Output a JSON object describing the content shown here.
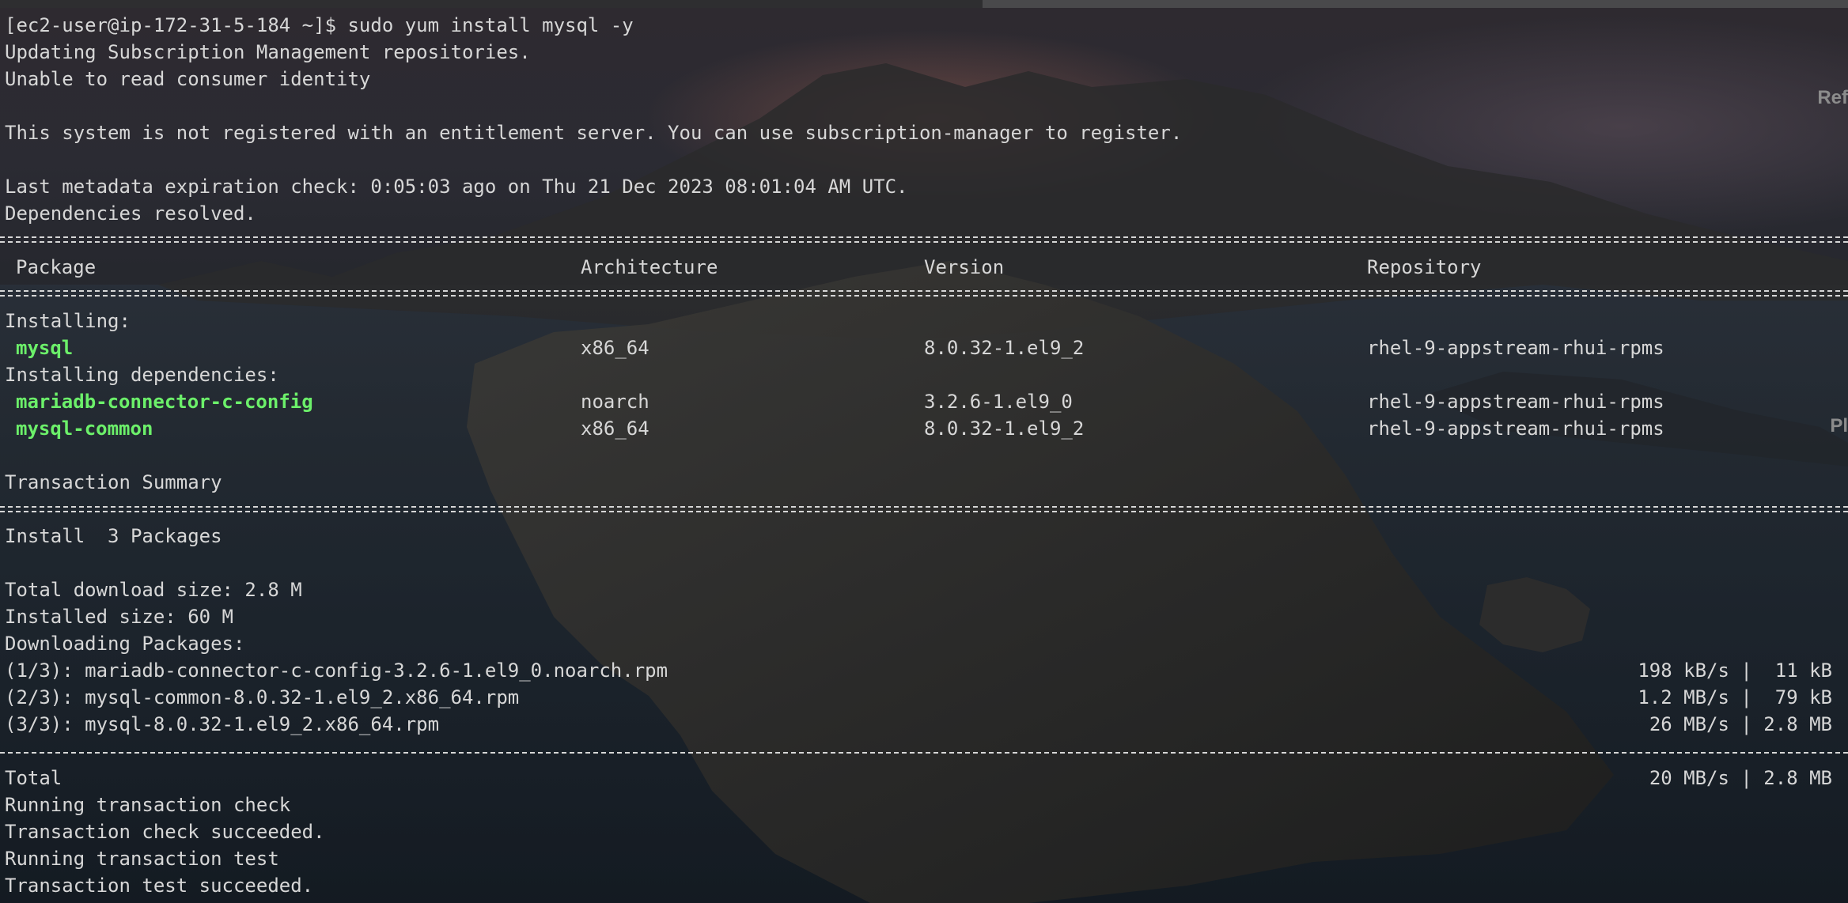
{
  "terminal": {
    "prompt": "[ec2-user@ip-172-31-5-184 ~]$ sudo yum install mysql -y",
    "line_updating": "Updating Subscription Management repositories.",
    "line_unable": "Unable to read consumer identity",
    "line_not_registered": "This system is not registered with an entitlement server. You can use subscription-manager to register.",
    "line_metadata": "Last metadata expiration check: 0:05:03 ago on Thu 21 Dec 2023 08:01:04 AM UTC.",
    "line_deps_resolved": "Dependencies resolved.",
    "table": {
      "headers": {
        "package": "Package",
        "architecture": "Architecture",
        "version": "Version",
        "repository": "Repository"
      },
      "installing_label": "Installing:",
      "installing": [
        {
          "name": "mysql",
          "arch": "x86_64",
          "version": "8.0.32-1.el9_2",
          "repo": "rhel-9-appstream-rhui-rpms"
        }
      ],
      "deps_label": "Installing dependencies:",
      "dependencies": [
        {
          "name": "mariadb-connector-c-config",
          "arch": "noarch",
          "version": "3.2.6-1.el9_0",
          "repo": "rhel-9-appstream-rhui-rpms"
        },
        {
          "name": "mysql-common",
          "arch": "x86_64",
          "version": "8.0.32-1.el9_2",
          "repo": "rhel-9-appstream-rhui-rpms"
        }
      ]
    },
    "transaction_summary": "Transaction Summary",
    "install_count": "Install  3 Packages",
    "total_download": "Total download size: 2.8 M",
    "installed_size": "Installed size: 60 M",
    "downloading": "Downloading Packages:",
    "downloads": [
      {
        "file": "(1/3): mariadb-connector-c-config-3.2.6-1.el9_0.noarch.rpm",
        "stats": "198 kB/s |  11 kB"
      },
      {
        "file": "(2/3): mysql-common-8.0.32-1.el9_2.x86_64.rpm",
        "stats": "1.2 MB/s |  79 kB"
      },
      {
        "file": "(3/3): mysql-8.0.32-1.el9_2.x86_64.rpm",
        "stats": "26 MB/s | 2.8 MB"
      }
    ],
    "total_label": "Total",
    "total_stats": "20 MB/s | 2.8 MB",
    "line_running_check": "Running transaction check",
    "line_check_ok": "Transaction check succeeded.",
    "line_running_test": "Running transaction test",
    "line_test_ok": "Transaction test succeeded."
  },
  "edge": {
    "ref": "Ref",
    "pl": "Pl"
  },
  "colors": {
    "text": "#d7d7d7",
    "package_highlight": "#6cf06a"
  }
}
